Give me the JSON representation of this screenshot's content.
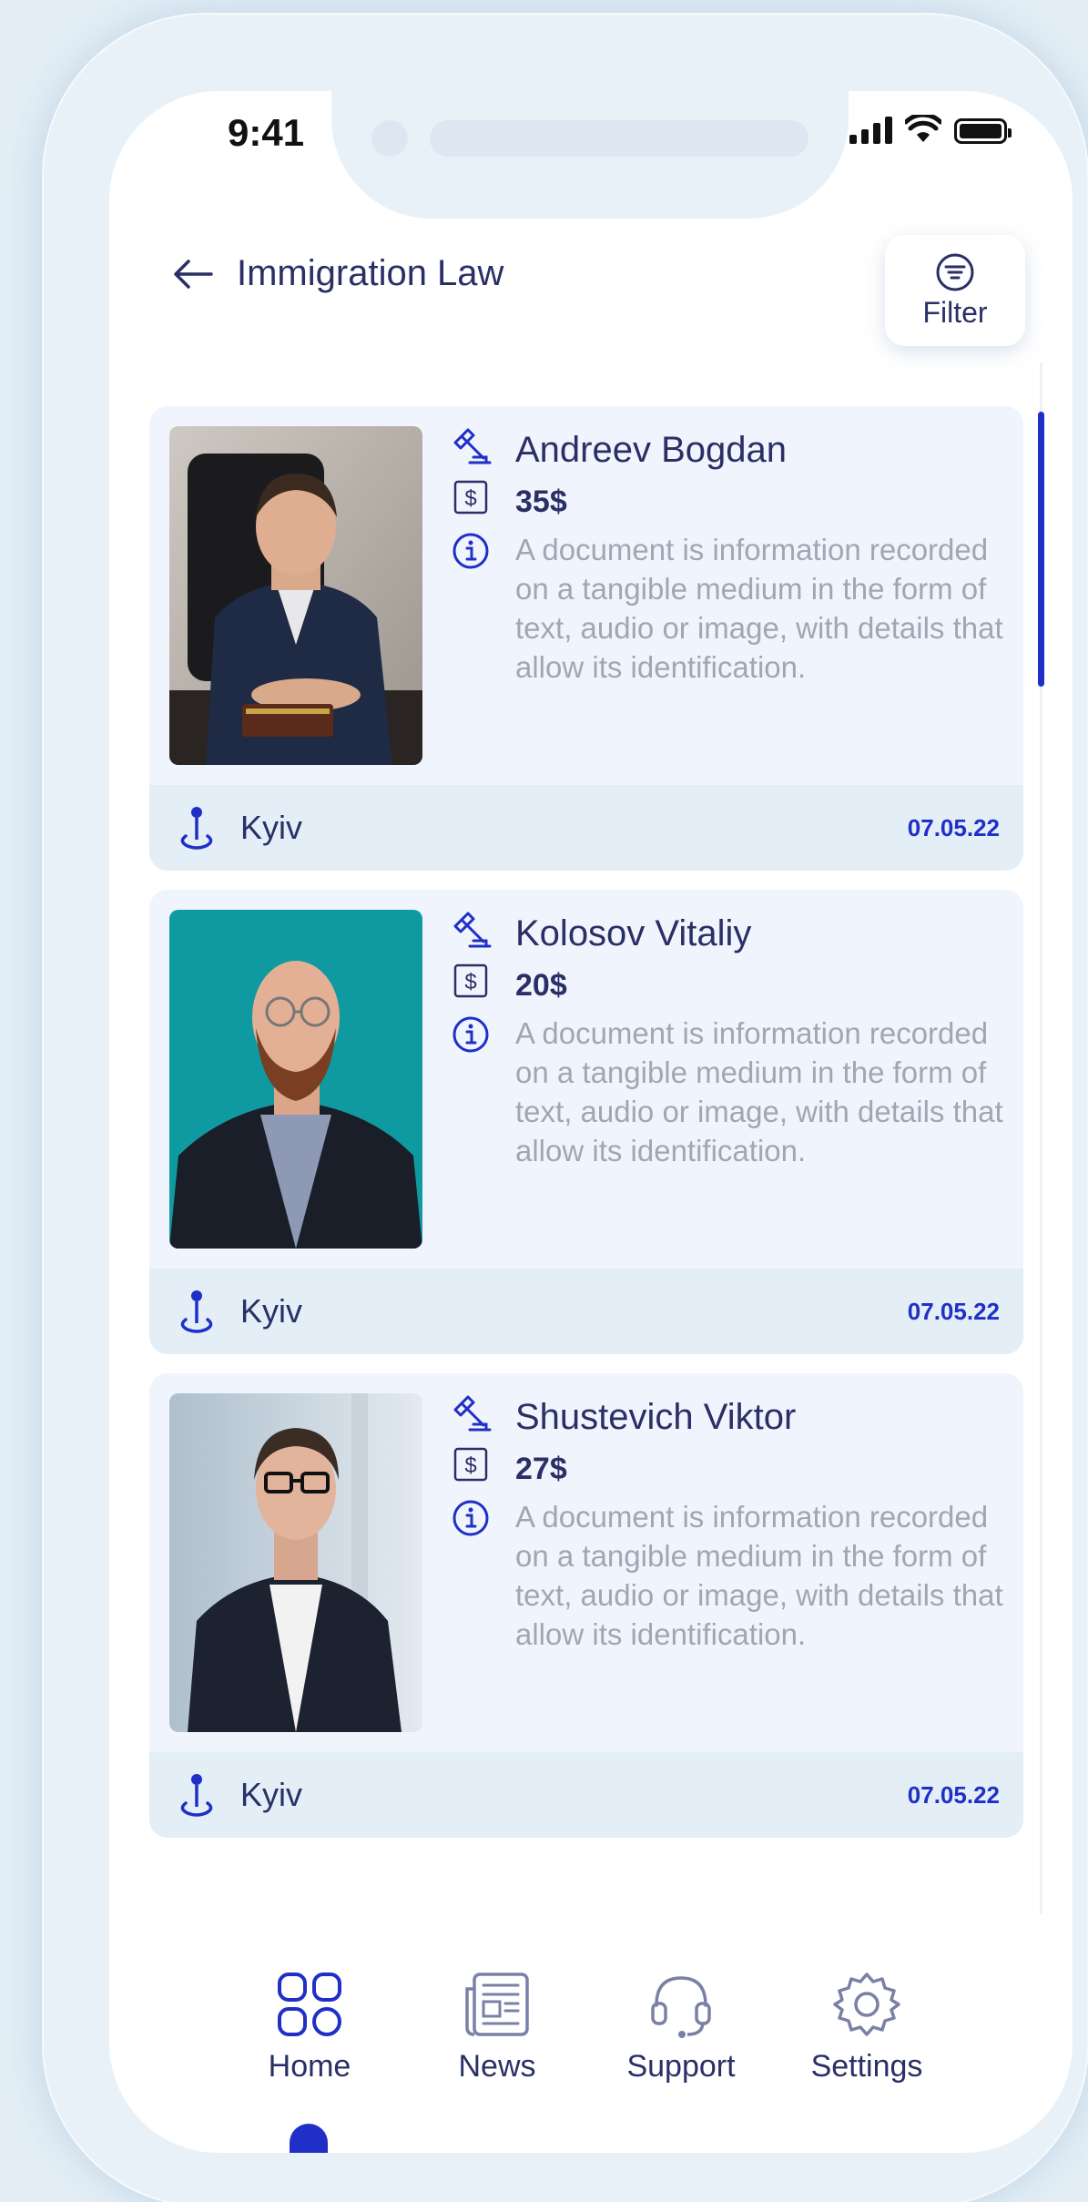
{
  "status": {
    "time": "9:41"
  },
  "header": {
    "title": "Immigration Law",
    "filter_label": "Filter"
  },
  "lawyers": [
    {
      "name": "Andreev Bogdan",
      "price": "35$",
      "description": "A document is information recorded on a tangible medium in the form of text, audio or image, with details that allow its identification.",
      "city": "Kyiv",
      "date": "07.05.22"
    },
    {
      "name": "Kolosov Vitaliy",
      "price": "20$",
      "description": "A document is information recorded on a tangible medium in the form of text, audio or image, with details that allow its identification.",
      "city": "Kyiv",
      "date": "07.05.22"
    },
    {
      "name": "Shustevich Viktor",
      "price": "27$",
      "description": "A document is information recorded on a tangible medium in the form of text, audio or image, with details that allow its identification.",
      "city": "Kyiv",
      "date": "07.05.22"
    }
  ],
  "nav": {
    "items": [
      {
        "label": "Home",
        "icon": "home-grid-icon",
        "active": true
      },
      {
        "label": "News",
        "icon": "news-icon",
        "active": false
      },
      {
        "label": "Support",
        "icon": "headset-icon",
        "active": false
      },
      {
        "label": "Settings",
        "icon": "gear-icon",
        "active": false
      }
    ]
  },
  "colors": {
    "accent": "#1f2fc8",
    "text_dark": "#2a2f66",
    "text_muted": "#a2a6b4",
    "card_bg": "#f0f5fd",
    "card_footer_bg": "#e3eef6"
  }
}
